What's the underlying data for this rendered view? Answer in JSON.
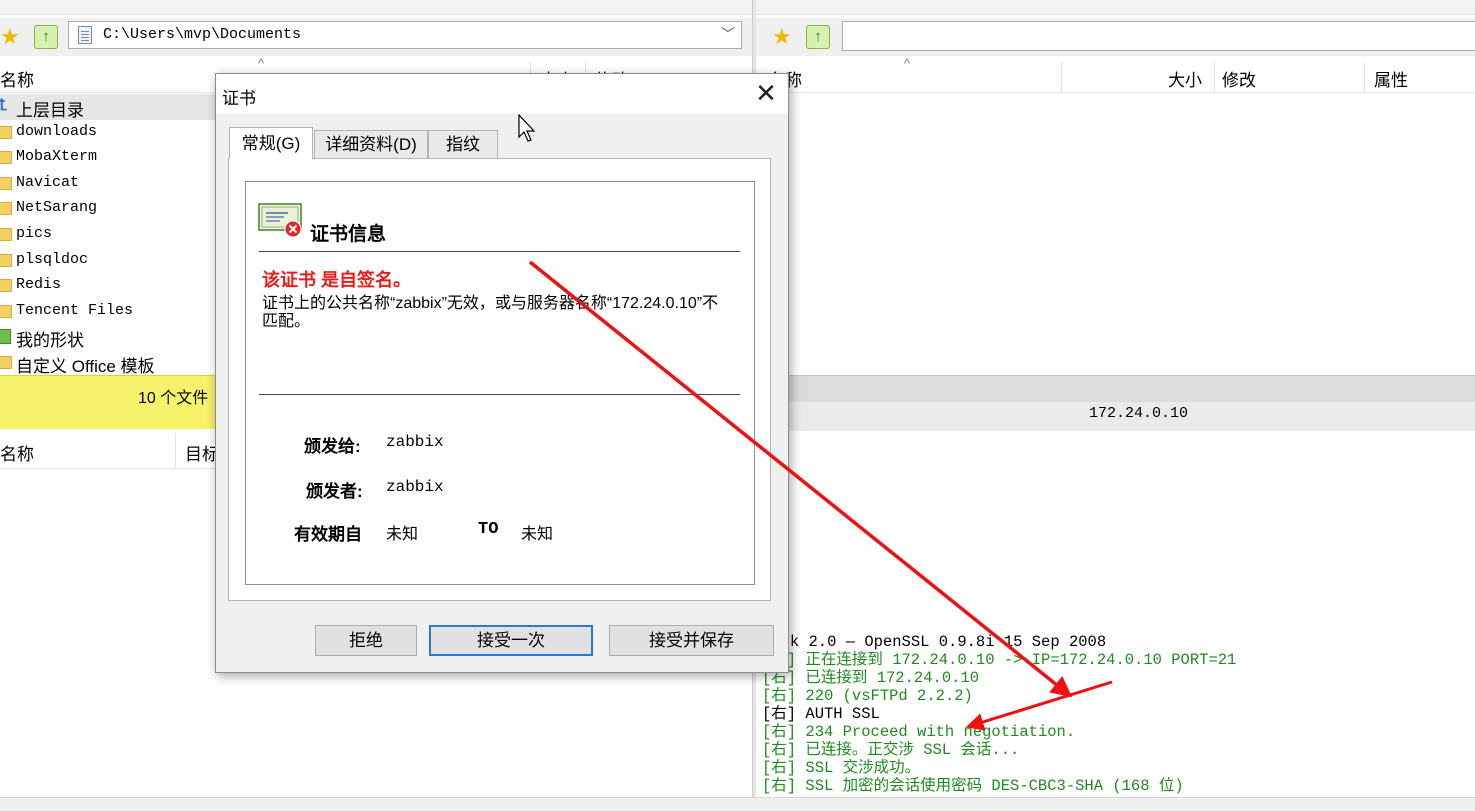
{
  "left_panel": {
    "path": "C:\\Users\\mvp\\Documents",
    "columns": {
      "name": "名称",
      "size": "大小",
      "modified": "修改"
    },
    "files": [
      {
        "label": "上层目录",
        "type": "parent"
      },
      {
        "label": "downloads",
        "type": "folder"
      },
      {
        "label": "MobaXterm",
        "type": "folder"
      },
      {
        "label": "Navicat",
        "type": "folder"
      },
      {
        "label": "NetSarang",
        "type": "folder"
      },
      {
        "label": "pics",
        "type": "folder"
      },
      {
        "label": "plsqldoc",
        "type": "folder"
      },
      {
        "label": "Redis",
        "type": "folder"
      },
      {
        "label": "Tencent Files",
        "type": "folder"
      },
      {
        "label": "我的形状",
        "type": "shapes"
      },
      {
        "label": "自定义 Office 模板",
        "type": "folder"
      }
    ],
    "status_text": "10 个文件",
    "lower_columns": {
      "name": "名称",
      "target": "目标"
    }
  },
  "right_panel": {
    "path_value": "",
    "columns": {
      "name": "名称",
      "size": "大小",
      "modified": "修改",
      "attributes": "属性"
    },
    "status_ip": "172.24.0.10",
    "log": [
      {
        "text": "Sock 2.0 — OpenSSL 0.9.8i 15 Sep 2008",
        "color": "black"
      },
      {
        "text": "[右] 正在连接到 172.24.0.10 -> IP=172.24.0.10 PORT=21",
        "color": "green"
      },
      {
        "text": "[右] 已连接到 172.24.0.10",
        "color": "green"
      },
      {
        "text": "[右] 220 (vsFTPd 2.2.2)",
        "color": "green"
      },
      {
        "text": "[右] AUTH SSL",
        "color": "black"
      },
      {
        "text": "[右] 234 Proceed with negotiation.",
        "color": "green"
      },
      {
        "text": "[右] 已连接。正交涉 SSL 会话...",
        "color": "green"
      },
      {
        "text": "[右] SSL 交涉成功。",
        "color": "green"
      },
      {
        "text": "[右] SSL 加密的会话使用密码 DES-CBC3-SHA (168 位)",
        "color": "green"
      }
    ]
  },
  "dialog": {
    "title": "证书",
    "tabs": [
      "常规(G)",
      "详细资料(D)",
      "指纹"
    ],
    "section_title": "证书信息",
    "warning": "该证书 是自签名。",
    "message": "证书上的公共名称“zabbix”无效，或与服务器名称“172.24.0.10”不匹配。",
    "issued_to_label": "颁发给:",
    "issued_to": "zabbix",
    "issued_by_label": "颁发者:",
    "issued_by": "zabbix",
    "valid_from_label": "有效期自",
    "valid_from": "未知",
    "valid_to_label": "TO",
    "valid_to": "未知",
    "buttons": {
      "reject": "拒绝",
      "accept_once": "接受一次",
      "accept_save": "接受并保存"
    }
  },
  "colors": {
    "accent": "#2f78d0",
    "warning_red": "#e81e1e",
    "log_green": "#1f8b1f",
    "arrow_red": "#ee1111",
    "status_yellow": "#f6f26a"
  }
}
